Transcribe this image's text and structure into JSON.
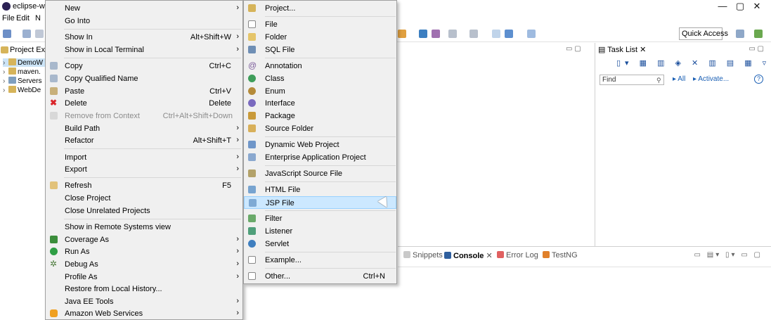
{
  "window": {
    "title": "eclipse-wor",
    "minimize": "—",
    "maximize": "▢",
    "close": "✕"
  },
  "menubar": [
    "File",
    "Edit",
    "N"
  ],
  "toolbar": {
    "quick_access": "Quick Access"
  },
  "project_explorer": {
    "tab": "Project Exp",
    "items": [
      "DemoW",
      "maven.",
      "Servers",
      "WebDe"
    ]
  },
  "task_list": {
    "tab": "Task List",
    "find_placeholder": "Find",
    "all": "All",
    "activate": "Activate..."
  },
  "bottom_views": {
    "tabs": [
      "Snippets",
      "Console",
      "Error Log",
      "TestNG"
    ],
    "console_close": "✕"
  },
  "context_menu": {
    "items": [
      {
        "label": "New",
        "submenu": true
      },
      {
        "label": "Go Into"
      },
      {
        "label": "Show In",
        "shortcut": "Alt+Shift+W",
        "submenu": true
      },
      {
        "label": "Show in Local Terminal",
        "submenu": true
      },
      {
        "label": "Copy",
        "shortcut": "Ctrl+C"
      },
      {
        "label": "Copy Qualified Name"
      },
      {
        "label": "Paste",
        "shortcut": "Ctrl+V"
      },
      {
        "label": "Delete",
        "shortcut": "Delete"
      },
      {
        "label": "Remove from Context",
        "shortcut": "Ctrl+Alt+Shift+Down"
      },
      {
        "label": "Build Path",
        "submenu": true
      },
      {
        "label": "Refactor",
        "shortcut": "Alt+Shift+T",
        "submenu": true
      },
      {
        "label": "Import",
        "submenu": true
      },
      {
        "label": "Export",
        "submenu": true
      },
      {
        "label": "Refresh",
        "shortcut": "F5"
      },
      {
        "label": "Close Project"
      },
      {
        "label": "Close Unrelated Projects"
      },
      {
        "label": "Show in Remote Systems view"
      },
      {
        "label": "Coverage As",
        "submenu": true
      },
      {
        "label": "Run As",
        "submenu": true
      },
      {
        "label": "Debug As",
        "submenu": true
      },
      {
        "label": "Profile As",
        "submenu": true
      },
      {
        "label": "Restore from Local History..."
      },
      {
        "label": "Java EE Tools",
        "submenu": true
      },
      {
        "label": "Amazon Web Services",
        "submenu": true
      }
    ]
  },
  "new_submenu": {
    "items": [
      {
        "label": "Project..."
      },
      {
        "label": "File"
      },
      {
        "label": "Folder"
      },
      {
        "label": "SQL File"
      },
      {
        "label": "Annotation"
      },
      {
        "label": "Class"
      },
      {
        "label": "Enum"
      },
      {
        "label": "Interface"
      },
      {
        "label": "Package"
      },
      {
        "label": "Source Folder"
      },
      {
        "label": "Dynamic Web Project"
      },
      {
        "label": "Enterprise Application Project"
      },
      {
        "label": "JavaScript Source File"
      },
      {
        "label": "HTML File"
      },
      {
        "label": "JSP File"
      },
      {
        "label": "Filter"
      },
      {
        "label": "Listener"
      },
      {
        "label": "Servlet"
      },
      {
        "label": "Example..."
      },
      {
        "label": "Other...",
        "shortcut": "Ctrl+N"
      }
    ]
  },
  "colors": {
    "menu_bg": "#f0f0f0",
    "highlight": "#cce8ff",
    "link": "#1a5fb4"
  }
}
